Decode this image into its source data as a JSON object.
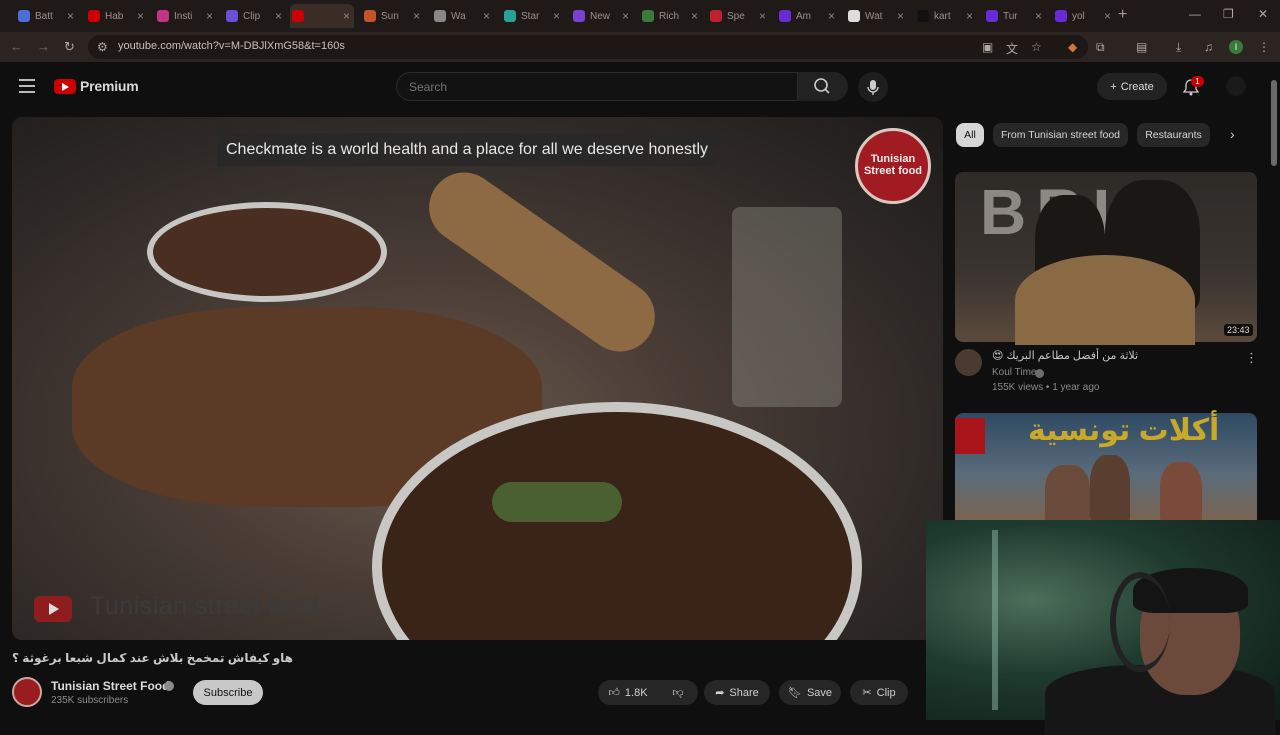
{
  "tabs": [
    {
      "label": "Batt",
      "color": "#4a6fd6"
    },
    {
      "label": "Hab",
      "color": "#cc0000"
    },
    {
      "label": "Insti",
      "color": "#c13584"
    },
    {
      "label": "Clip",
      "color": "#6b4fd6"
    },
    {
      "label": "",
      "color": "#cc0000"
    },
    {
      "label": "Sun",
      "color": "#c4542a"
    },
    {
      "label": "Wa",
      "color": "#888888"
    },
    {
      "label": "Star",
      "color": "#2aa198"
    },
    {
      "label": "New",
      "color": "#7b3fd1"
    },
    {
      "label": "Rich",
      "color": "#3c7a3c"
    },
    {
      "label": "Spe",
      "color": "#c0222a"
    },
    {
      "label": "Am",
      "color": "#6a2bd6"
    },
    {
      "label": "Wat",
      "color": "#dddddd"
    },
    {
      "label": "kart",
      "color": "#111111"
    },
    {
      "label": "Tur",
      "color": "#6a2bd6"
    },
    {
      "label": "yol",
      "color": "#6a2bd6"
    }
  ],
  "browser": {
    "url": "youtube.com/watch?v=M-DBJlXmG58&t=160s",
    "new_tab": "+",
    "profile_initial": "I"
  },
  "header": {
    "logo_text": "Premium",
    "search_placeholder": "Search",
    "create_label": "Create",
    "notification_count": "1"
  },
  "player": {
    "caption": "Checkmate is a world health and a place for all we deserve honestly",
    "badge_text": "Tunisian Street food",
    "watermark": "Tunisian street food"
  },
  "video": {
    "title": "هاو كيفاش تمخمخ بلاش عند كمال شبعا برغوثة ؟",
    "channel": "Tunisian Street Food",
    "subscribers": "235K subscribers",
    "subscribe_label": "Subscribe",
    "likes": "1.8K",
    "share_label": "Share",
    "save_label": "Save",
    "clip_label": "Clip"
  },
  "chips": [
    {
      "label": "All",
      "active": true
    },
    {
      "label": "From Tunisian street food",
      "active": false
    },
    {
      "label": "Restaurants",
      "active": false
    }
  ],
  "recommendations": [
    {
      "thumb_text": "BRIK",
      "duration": "23:43",
      "title": "ثلاثة من أفضل مطاعم البريك 😍",
      "channel": "Koul Time",
      "meta": "155K views • 1 year ago"
    },
    {
      "thumb_text": "أكلات تونسية"
    }
  ]
}
